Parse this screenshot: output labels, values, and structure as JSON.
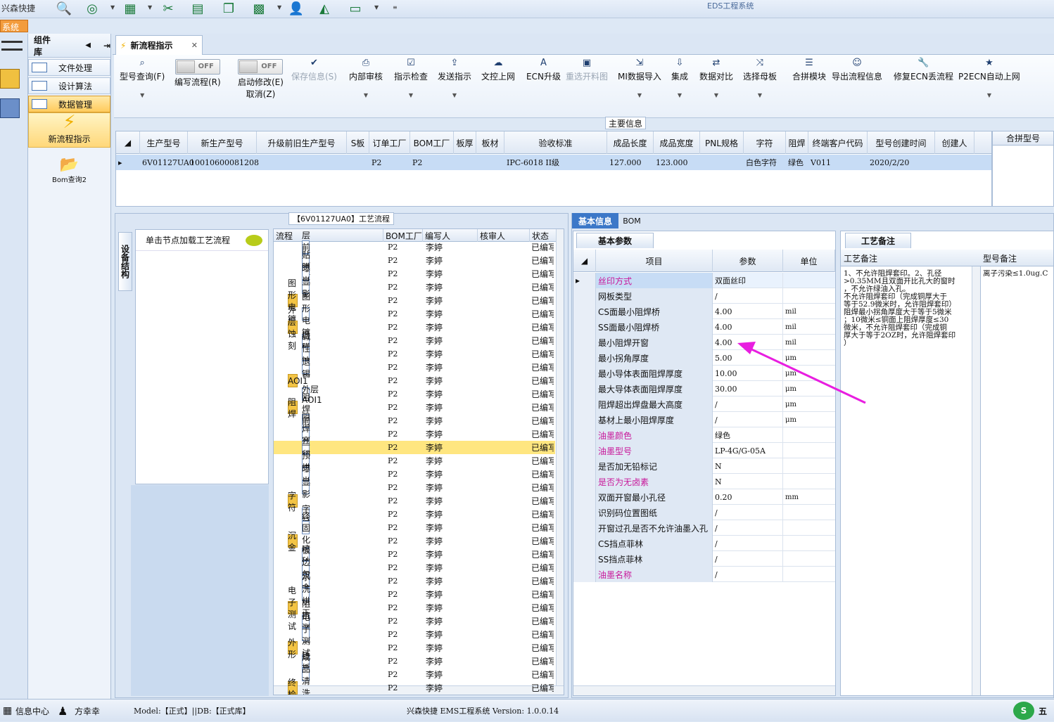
{
  "window": {
    "title": "EDS工程系统",
    "quick_label": "兴森快捷",
    "sys_tag": "系统"
  },
  "component_lib": {
    "title": "组件库",
    "items": [
      {
        "label": "文件处理"
      },
      {
        "label": "设计算法"
      },
      {
        "label": "数据管理"
      }
    ],
    "big_items": [
      {
        "label": "新流程指示"
      },
      {
        "label": "Bom查询2"
      }
    ]
  },
  "tab": {
    "label": "新流程指示"
  },
  "ribbon": {
    "buttons": [
      {
        "label": "型号查询(F)",
        "icon": "search-icon",
        "enabled": true
      },
      {
        "label": "编写流程(R)",
        "icon": "toggle-off",
        "enabled": true
      },
      {
        "label": "启动修改(E)",
        "sub": "取消(Z)",
        "icon": "toggle-off",
        "enabled": true
      },
      {
        "label": "保存信息(S)",
        "icon": "check-icon",
        "enabled": false
      },
      {
        "label": "内部审核",
        "icon": "print-icon",
        "enabled": true
      },
      {
        "label": "指示检查",
        "icon": "checkbox-icon",
        "enabled": true
      },
      {
        "label": "发送指示",
        "icon": "upload-icon",
        "enabled": true
      },
      {
        "label": "文控上网",
        "icon": "cloud-upload-icon",
        "enabled": true
      },
      {
        "label": "ECN升级",
        "icon": "font-icon",
        "enabled": true
      },
      {
        "label": "重选开料图",
        "icon": "image-icon",
        "enabled": false
      },
      {
        "label": "MI数据导入",
        "icon": "import-icon",
        "enabled": true
      },
      {
        "label": "集成",
        "icon": "download-icon",
        "enabled": true
      },
      {
        "label": "数据对比",
        "icon": "compare-icon",
        "enabled": true
      },
      {
        "label": "选择母板",
        "icon": "shuffle-icon",
        "enabled": true
      },
      {
        "label": "合拼模块",
        "icon": "list-icon",
        "enabled": true
      },
      {
        "label": "导出流程信息",
        "icon": "smile-icon",
        "enabled": true
      },
      {
        "label": "修复ECN丢流程",
        "icon": "wrench-icon",
        "enabled": true
      },
      {
        "label": "P2ECN自动上网",
        "icon": "star-icon",
        "enabled": true
      }
    ],
    "toggle_text": "OFF"
  },
  "main_info": {
    "label": "主要信息",
    "columns": [
      "生产型号",
      "新生产型号",
      "升级前旧生产型号",
      "S板",
      "订单工厂",
      "BOM工厂",
      "板厚",
      "板材",
      "验收标准",
      "成品长度",
      "成品宽度",
      "PNL规格",
      "字符",
      "阻焊",
      "终端客户代码",
      "型号创建时间",
      "创建人"
    ],
    "row": [
      "6V01127UA0",
      "10010600081208",
      "",
      "",
      "P2",
      "P2",
      "",
      "",
      "IPC-6018 II级",
      "127.000",
      "123.000",
      "",
      "白色字符",
      "绿色",
      "V011",
      "2020/2/20",
      ""
    ],
    "merge_header": "合拼型号"
  },
  "left": {
    "side_tab": "设备结构",
    "load_hint": "单击节点加载工艺流程",
    "flow_label": "【6V01127UA0】工艺流程"
  },
  "tree": {
    "columns": [
      "流程",
      "BOM工厂",
      "编写人",
      "核审人",
      "状态"
    ],
    "rows": [
      {
        "name": "外层前处理",
        "level": 1,
        "type": "doc",
        "bom": "P2",
        "writer": "李婷",
        "status": "已编写"
      },
      {
        "name": "贴膜",
        "level": 1,
        "type": "doc",
        "bom": "P2",
        "writer": "李婷",
        "status": "已编写"
      },
      {
        "name": "曝光",
        "level": 1,
        "type": "doc",
        "bom": "P2",
        "writer": "李婷",
        "status": "已编写"
      },
      {
        "name": "显影",
        "level": 1,
        "type": "doc",
        "bom": "P2",
        "writer": "李婷",
        "status": "已编写"
      },
      {
        "name": "图形电镀",
        "level": 0,
        "type": "folder",
        "bom": "P2",
        "writer": "李婷",
        "status": "已编写"
      },
      {
        "name": "图形电镀",
        "level": 1,
        "type": "doc",
        "bom": "P2",
        "writer": "李婷",
        "status": "已编写"
      },
      {
        "name": "外层蚀刻",
        "level": 0,
        "type": "folder",
        "bom": "P2",
        "writer": "李婷",
        "status": "已编写"
      },
      {
        "name": "退膜",
        "level": 1,
        "type": "doc",
        "bom": "P2",
        "writer": "李婷",
        "status": "已编写"
      },
      {
        "name": "碱性蚀刻",
        "level": 1,
        "type": "doc",
        "bom": "P2",
        "writer": "李婷",
        "status": "已编写"
      },
      {
        "name": "退锡",
        "level": 1,
        "type": "doc",
        "bom": "P2",
        "writer": "李婷",
        "status": "已编写"
      },
      {
        "name": "AOI1",
        "level": 0,
        "type": "folder",
        "bom": "P2",
        "writer": "李婷",
        "status": "已编写"
      },
      {
        "name": "外层AOI1",
        "level": 1,
        "type": "doc",
        "bom": "P2",
        "writer": "李婷",
        "status": "已编写"
      },
      {
        "name": "阻焊",
        "level": 0,
        "type": "folder",
        "bom": "P2",
        "writer": "李婷",
        "status": "已编写"
      },
      {
        "name": "阻焊前处理",
        "level": 1,
        "type": "doc",
        "bom": "P2",
        "writer": "李婷",
        "status": "已编写"
      },
      {
        "name": "阻焊塞孔",
        "level": 1,
        "type": "doc",
        "bom": "P2",
        "writer": "李婷",
        "status": "已编写"
      },
      {
        "name": "丝印",
        "level": 1,
        "type": "doc",
        "bom": "P2",
        "writer": "李婷",
        "status": "已编写",
        "selected": true
      },
      {
        "name": "预烘",
        "level": 1,
        "type": "doc",
        "bom": "P2",
        "writer": "李婷",
        "status": "已编写"
      },
      {
        "name": "曝光",
        "level": 1,
        "type": "doc",
        "bom": "P2",
        "writer": "李婷",
        "status": "已编写"
      },
      {
        "name": "显影",
        "level": 1,
        "type": "doc",
        "bom": "P2",
        "writer": "李婷",
        "status": "已编写"
      },
      {
        "name": "字符",
        "level": 0,
        "type": "folder",
        "bom": "P2",
        "writer": "李婷",
        "status": "已编写"
      },
      {
        "name": "字符",
        "level": 1,
        "type": "doc",
        "bom": "P2",
        "writer": "李婷",
        "status": "已编写"
      },
      {
        "name": "终固化",
        "level": 1,
        "type": "doc",
        "bom": "P2",
        "writer": "李婷",
        "status": "已编写"
      },
      {
        "name": "沉金",
        "level": 0,
        "type": "folder",
        "bom": "P2",
        "writer": "李婷",
        "status": "已编写"
      },
      {
        "name": "喷砂",
        "level": 1,
        "type": "doc",
        "bom": "P2",
        "writer": "李婷",
        "status": "已编写"
      },
      {
        "name": "板边包胶",
        "level": 1,
        "type": "doc",
        "bom": "P2",
        "writer": "李婷",
        "status": "已编写"
      },
      {
        "name": "沉金",
        "level": 1,
        "type": "doc",
        "bom": "P2",
        "writer": "李婷",
        "status": "已编写"
      },
      {
        "name": "水洗烘干",
        "level": 1,
        "type": "doc",
        "bom": "P2",
        "writer": "李婷",
        "status": "已编写"
      },
      {
        "name": "电子测试",
        "level": 0,
        "type": "folder",
        "bom": "P2",
        "writer": "李婷",
        "status": "已编写"
      },
      {
        "name": "阻抗测试",
        "level": 1,
        "type": "doc",
        "bom": "P2",
        "writer": "李婷",
        "status": "已编写"
      },
      {
        "name": "电子测试",
        "level": 1,
        "type": "doc",
        "bom": "P2",
        "writer": "李婷",
        "status": "已编写"
      },
      {
        "name": "外形",
        "level": 0,
        "type": "folder",
        "bom": "P2",
        "writer": "李婷",
        "status": "已编写"
      },
      {
        "name": "铣板",
        "level": 1,
        "type": "doc",
        "bom": "P2",
        "writer": "李婷",
        "status": "已编写"
      },
      {
        "name": "成品清洗",
        "level": 1,
        "type": "doc",
        "bom": "P2",
        "writer": "李婷",
        "status": "已编写"
      },
      {
        "name": "终检",
        "level": 0,
        "type": "folder",
        "bom": "P2",
        "writer": "李婷",
        "status": "已编写"
      }
    ]
  },
  "right": {
    "tabs": [
      "基本信息",
      "BOM"
    ],
    "sub_tab": "基本参数",
    "columns": [
      "项目",
      "参数",
      "单位"
    ],
    "params": [
      {
        "k": "丝印方式",
        "v": "双面丝印",
        "u": "",
        "pink": true
      },
      {
        "k": "网板类型",
        "v": "/",
        "u": "",
        "pink": false
      },
      {
        "k": "CS面最小阻焊桥",
        "v": "4.00",
        "u": "mil",
        "pink": false
      },
      {
        "k": "SS面最小阻焊桥",
        "v": "4.00",
        "u": "mil",
        "pink": false
      },
      {
        "k": "最小阻焊开窗",
        "v": "4.00",
        "u": "mil",
        "pink": false
      },
      {
        "k": "最小拐角厚度",
        "v": "5.00",
        "u": "μm",
        "pink": false
      },
      {
        "k": "最小导体表面阻焊厚度",
        "v": "10.00",
        "u": "μm",
        "pink": false
      },
      {
        "k": "最大导体表面阻焊厚度",
        "v": "30.00",
        "u": "μm",
        "pink": false
      },
      {
        "k": "阻焊超出焊盘最大高度",
        "v": "/",
        "u": "μm",
        "pink": false
      },
      {
        "k": "基材上最小阻焊厚度",
        "v": "/",
        "u": "μm",
        "pink": false
      },
      {
        "k": "油墨颜色",
        "v": "绿色",
        "u": "",
        "pink": true
      },
      {
        "k": "油墨型号",
        "v": "LP-4G/G-05A",
        "u": "",
        "pink": true
      },
      {
        "k": "是否加无铅标记",
        "v": "N",
        "u": "",
        "pink": false
      },
      {
        "k": "是否为无卤素",
        "v": "N",
        "u": "",
        "pink": true
      },
      {
        "k": "双面开窗最小孔径",
        "v": "0.20",
        "u": "mm",
        "pink": false
      },
      {
        "k": "识别码位置图纸",
        "v": "/",
        "u": "",
        "pink": false
      },
      {
        "k": "开窗过孔是否不允许油墨入孔",
        "v": "/",
        "u": "",
        "pink": false
      },
      {
        "k": "CS挡点菲林",
        "v": "/",
        "u": "",
        "pink": false
      },
      {
        "k": "SS挡点菲林",
        "v": "/",
        "u": "",
        "pink": false
      },
      {
        "k": "油墨名称",
        "v": "/",
        "u": "",
        "pink": true
      }
    ],
    "craft_tab": "工艺备注",
    "craft_col": "工艺备注",
    "model_col": "型号备注",
    "craft_note": "1、不允许阻焊套印。2、孔径\n>0.35MM且双面开比孔大的窗时\n，不允许绿油入孔。\n不允许阻焊套印（完成铜厚大于\n等于52.9微米时，允许阻焊套印）\n阻焊最小拐角厚度大于等于5微米\n；10微米≤铜面上阻焊厚度≤30\n微米，不允许阻焊套印（完成铜\n厚大于等于2OZ时，允许阻焊套印\n）",
    "model_note": "离子污染≤1.0ug.C"
  },
  "status": {
    "msg_center": "信息中心",
    "user": "方幸幸",
    "model": "Model:【正式】||DB:【正式库】",
    "version": "兴森快捷  EMS工程系统  Version: 1.0.0.14",
    "ime": "五"
  },
  "colors": {
    "accent": "#ffcb5c",
    "selection": "#c7dcf5",
    "pink": "#c8189a",
    "arrow": "#e81ee0"
  }
}
